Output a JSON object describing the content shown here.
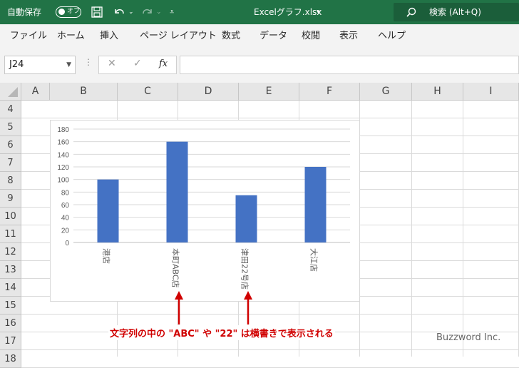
{
  "titlebar": {
    "autosave_label": "自動保存",
    "autosave_state": "オフ",
    "filename": "Excelグラフ.xlsx",
    "search_placeholder": "検索 (Alt+Q)"
  },
  "menu": [
    "ファイル",
    "ホーム",
    "挿入",
    "ページ レイアウト",
    "数式",
    "データ",
    "校閲",
    "表示",
    "ヘルプ"
  ],
  "formula_bar": {
    "name_box": "J24",
    "fx": "fx",
    "value": ""
  },
  "columns": [
    "A",
    "B",
    "C",
    "D",
    "E",
    "F",
    "G",
    "H",
    "I"
  ],
  "rows": [
    "4",
    "5",
    "6",
    "7",
    "8",
    "9",
    "10",
    "11",
    "12",
    "13",
    "14",
    "15",
    "16",
    "17",
    "18"
  ],
  "chart_data": {
    "type": "bar",
    "categories": [
      "港店",
      "本町ABC店",
      "津田22号店",
      "大江店"
    ],
    "values": [
      100,
      160,
      75,
      120
    ],
    "title": "",
    "xlabel": "",
    "ylabel": "",
    "ylim": [
      0,
      180
    ],
    "yticks": [
      0,
      20,
      40,
      60,
      80,
      100,
      120,
      140,
      160,
      180
    ],
    "grid": true,
    "bar_color": "#4472c4"
  },
  "annotation": {
    "text": "文字列の中の \"ABC\" や \"22\" は横書きで表示される",
    "color": "#d00000"
  },
  "watermark": "Buzzword Inc."
}
